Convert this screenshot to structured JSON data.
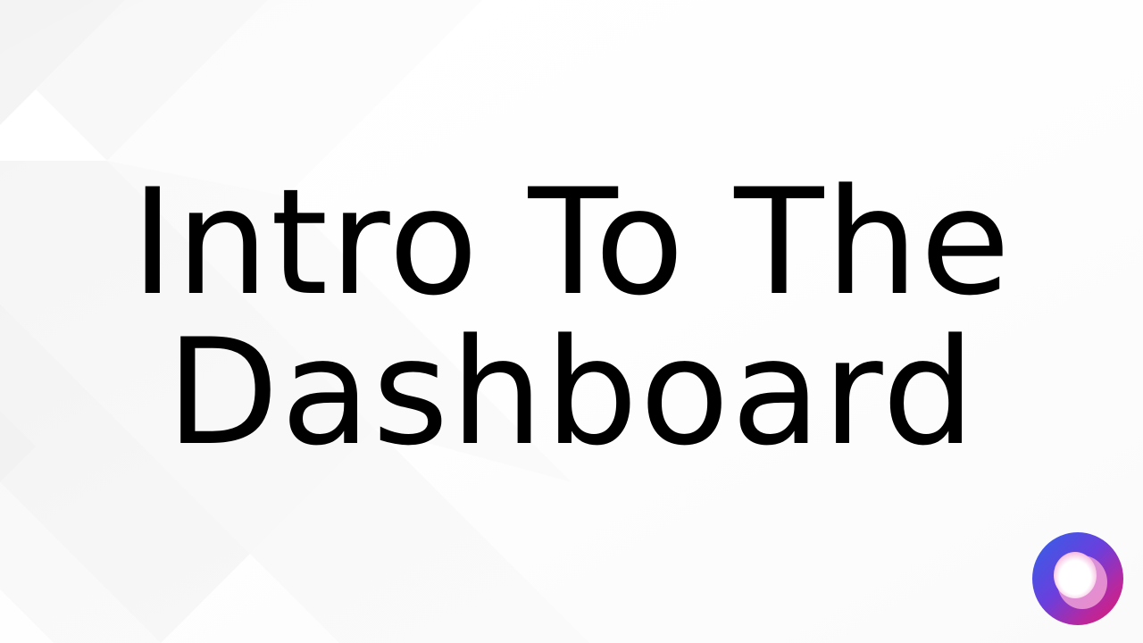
{
  "slide": {
    "title_lines": [
      "Intro To The",
      "Dashboard"
    ]
  },
  "logo": {
    "icon": "ring-logo-icon",
    "colors": {
      "blue": "#2f62e8",
      "purple": "#8f3bd6",
      "magenta": "#e0196e",
      "pink": "#f4a6d8"
    }
  },
  "background": {
    "color": "#ffffff",
    "stripe_color": "#f1f1f1"
  }
}
